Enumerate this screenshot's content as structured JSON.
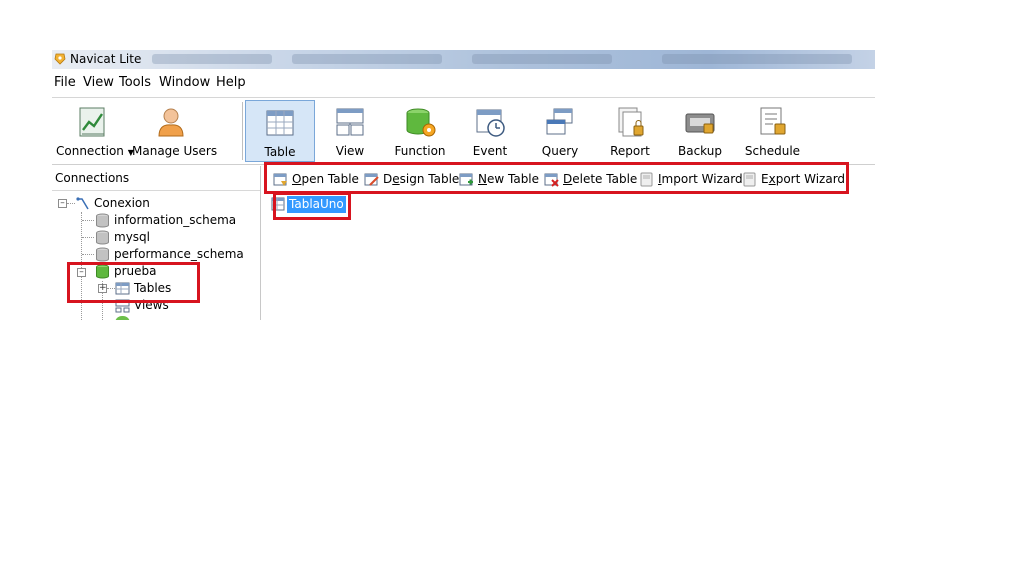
{
  "window": {
    "title": "Navicat Lite"
  },
  "menu": [
    "File",
    "View",
    "Tools",
    "Window",
    "Help"
  ],
  "toolbar": {
    "connection_label": "Connection",
    "manage_users_label": "Manage Users",
    "items": [
      {
        "label": "Table",
        "icon": "table-icon",
        "active": true
      },
      {
        "label": "View",
        "icon": "view-icon"
      },
      {
        "label": "Function",
        "icon": "function-icon"
      },
      {
        "label": "Event",
        "icon": "event-icon"
      },
      {
        "label": "Query",
        "icon": "query-icon"
      },
      {
        "label": "Report",
        "icon": "report-icon"
      },
      {
        "label": "Backup",
        "icon": "backup-icon"
      },
      {
        "label": "Schedule",
        "icon": "schedule-icon"
      }
    ]
  },
  "sidebar": {
    "header": "Connections",
    "tree": [
      {
        "label": "Conexion",
        "icon": "connection-icon"
      },
      {
        "label": "information_schema",
        "icon": "database-icon"
      },
      {
        "label": "mysql",
        "icon": "database-icon"
      },
      {
        "label": "performance_schema",
        "icon": "database-icon"
      },
      {
        "label": "prueba",
        "icon": "database-open-icon"
      },
      {
        "label": "Tables",
        "icon": "tables-folder-icon"
      },
      {
        "label": "Views",
        "icon": "views-folder-icon"
      }
    ]
  },
  "objectbar": {
    "open_table": {
      "hotkey": "O",
      "rest": "pen Table"
    },
    "design_table": {
      "pre": "D",
      "hotkey": "e",
      "rest": "sign Table"
    },
    "new_table": {
      "hotkey": "N",
      "rest": "ew Table"
    },
    "delete_table": {
      "hotkey": "D",
      "rest": "elete Table"
    },
    "import_wizard": {
      "hotkey": "I",
      "rest": "mport Wizard"
    },
    "export_wizard": {
      "pre": "E",
      "hotkey": "x",
      "rest": "port Wizard"
    }
  },
  "tables": [
    "TablaUno"
  ],
  "colors": {
    "highlight": "#d7141f",
    "selection": "#3399ff",
    "active_tab": "#d6e6f7"
  }
}
